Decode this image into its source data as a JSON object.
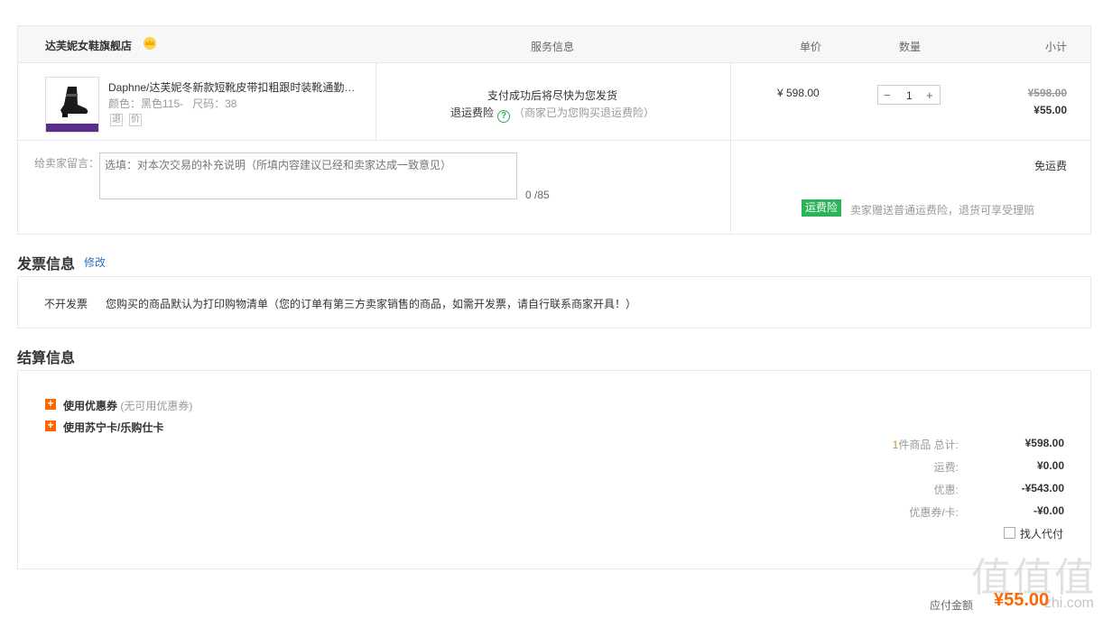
{
  "store": {
    "name": "达芙妮女鞋旗舰店",
    "badge_icon": "crown-icon"
  },
  "headers": {
    "service": "服务信息",
    "unit_price": "单价",
    "quantity": "数量",
    "subtotal": "小计"
  },
  "item": {
    "title": "Daphne/达芙妮冬新款短靴皮带扣粗跟时装靴通勤…",
    "spec": "颜色：黑色115-   尺码：38",
    "tags": [
      "退",
      "价"
    ],
    "service_line1": "支付成功后将尽快为您发货",
    "service_link": "退运费险",
    "service_note": "（商家已为您购买退运费险）",
    "unit_price": "¥ 598.00",
    "quantity": "1",
    "original_total": "¥598.00",
    "subtotal": "¥55.00"
  },
  "memo": {
    "label": "给卖家留言：",
    "placeholder": "选填：对本次交易的补充说明（所填内容建议已经和卖家达成一致意见）",
    "counter": "0 /85"
  },
  "shipping": {
    "free_text": "免运费",
    "insurance_badge": "运费险",
    "insurance_text": "卖家赠送普通运费险，退货可享受理赔"
  },
  "invoice": {
    "title": "发票信息",
    "edit": "修改",
    "type": "不开发票",
    "description": "您购买的商品默认为打印购物清单（您的订单有第三方卖家销售的商品，如需开发票，请自行联系商家开具！）"
  },
  "settlement": {
    "title": "结算信息",
    "coupon_label": "使用优惠券",
    "coupon_note": "(无可用优惠券)",
    "card_label": "使用苏宁卡/乐购仕卡",
    "count_prefix": "1",
    "total_label": "件商品 总计:",
    "total_value": "¥598.00",
    "shipping_label": "运费:",
    "shipping_value": "¥0.00",
    "discount_label": "优惠:",
    "discount_value": "-¥543.00",
    "voucher_label": "优惠券/卡:",
    "voucher_value": "-¥0.00",
    "proxy_pay": "找人代付"
  },
  "payable": {
    "label": "应付金额",
    "value": "¥55.00"
  },
  "watermark": {
    "glyphs": "值值值",
    "sub": "zhi.com"
  },
  "colors": {
    "accent": "#ff6600",
    "link": "#2a72c5",
    "green": "#2bb35a"
  }
}
